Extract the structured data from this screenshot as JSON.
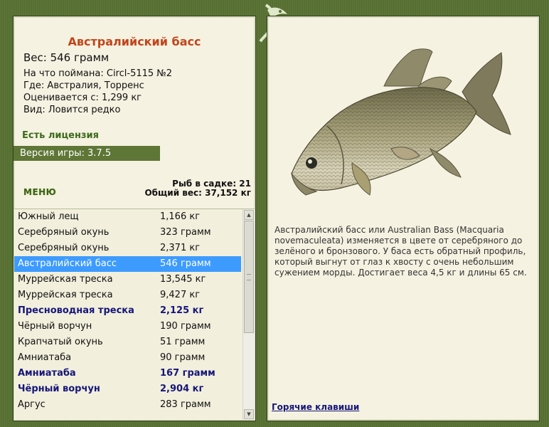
{
  "fish": {
    "title": "Австралийский басс",
    "weight": "Вес: 546 грамм",
    "caught_with": "На что поймана: Circl-5115 №2",
    "location": "Где: Австралия, Торренс",
    "value": "Оценивается с: 1,299 кг",
    "rarity": "Вид: Ловится редко"
  },
  "license": "Есть лицензия",
  "version": "Версия игры: 3.7.5",
  "menu_label": "МЕНЮ",
  "stats": {
    "fish_count": "Рыб в садке: 21",
    "total_weight": "Общий вес: 37,152 кг"
  },
  "catch_list": [
    {
      "name": "Южный лещ",
      "weight": "1,166 кг",
      "bold": false,
      "selected": false
    },
    {
      "name": "Серебряный окунь",
      "weight": "323 грамм",
      "bold": false,
      "selected": false
    },
    {
      "name": "Серебряный окунь",
      "weight": "2,371 кг",
      "bold": false,
      "selected": false
    },
    {
      "name": "Австралийский басс",
      "weight": "546 грамм",
      "bold": false,
      "selected": true
    },
    {
      "name": "Муррейская треска",
      "weight": "13,545 кг",
      "bold": false,
      "selected": false
    },
    {
      "name": "Муррейская треска",
      "weight": "9,427 кг",
      "bold": false,
      "selected": false
    },
    {
      "name": "Пресноводная треска",
      "weight": "2,125 кг",
      "bold": true,
      "selected": false
    },
    {
      "name": "Чёрный ворчун",
      "weight": "190 грамм",
      "bold": false,
      "selected": false
    },
    {
      "name": "Крапчатый окунь",
      "weight": "51 грамм",
      "bold": false,
      "selected": false
    },
    {
      "name": "Амниатаба",
      "weight": "90 грамм",
      "bold": false,
      "selected": false
    },
    {
      "name": "Амниатаба",
      "weight": "167 грамм",
      "bold": true,
      "selected": false
    },
    {
      "name": "Чёрный ворчун",
      "weight": "2,904 кг",
      "bold": true,
      "selected": false
    },
    {
      "name": "Аргус",
      "weight": "283 грамм",
      "bold": false,
      "selected": false
    }
  ],
  "description": "Австралийский басс или Australian Bass (Macquaria novemaculeata) изменяется в цвете от серебряного до зелёного и бронзового. У баса есть обратный профиль, который выгнут от глаз к хвосту с очень небольшим сужением морды. Достигает веса 4,5 кг и длины 65 см.",
  "hotkeys_label": "Горячие клавиши",
  "colors": {
    "frame": "#566f31",
    "panel": "#f5f2e1",
    "title": "#c2441b",
    "selection": "#3d9bff",
    "bold_row": "#16167a",
    "license": "#3c6a1c"
  }
}
